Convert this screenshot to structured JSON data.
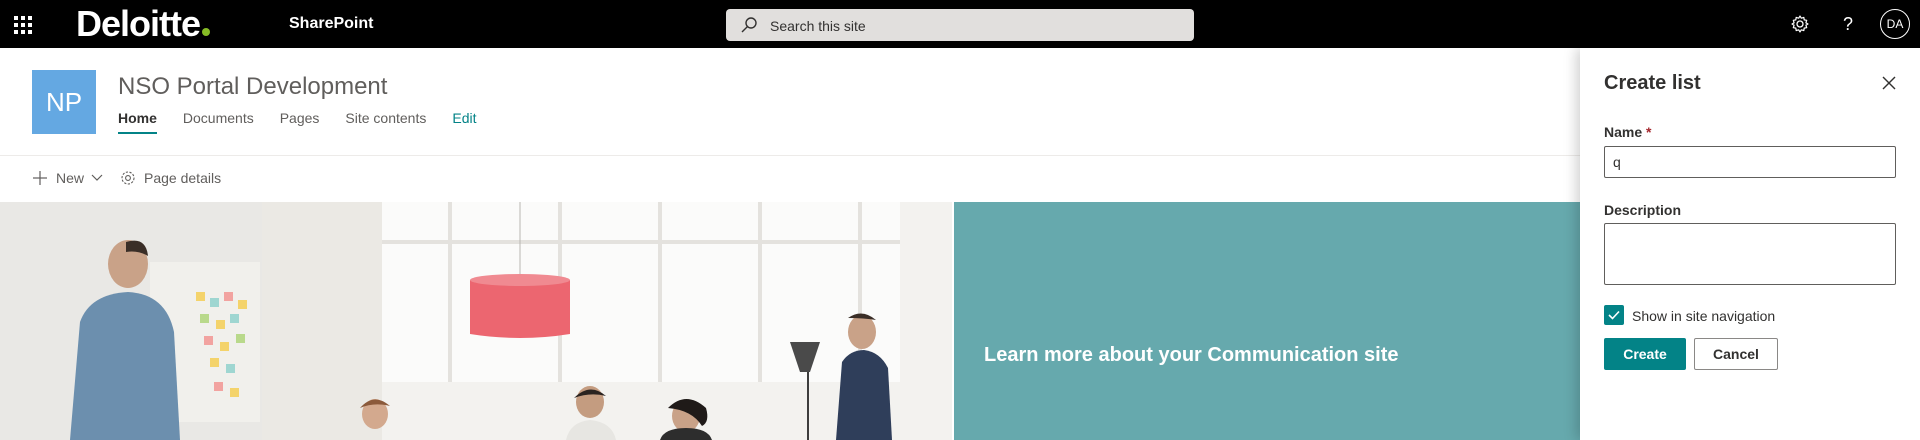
{
  "suitebar": {
    "brand": "Deloitte",
    "app_name": "SharePoint",
    "search_placeholder": "Search this site",
    "avatar_initials": "DA",
    "icons": [
      "app-launcher-icon",
      "settings-icon",
      "help-icon"
    ]
  },
  "site": {
    "logo_initials": "NP",
    "logo_color": "#64a8e2",
    "title": "NSO Portal Development",
    "nav": [
      {
        "label": "Home",
        "active": true
      },
      {
        "label": "Documents"
      },
      {
        "label": "Pages"
      },
      {
        "label": "Site contents"
      },
      {
        "label": "Edit"
      }
    ]
  },
  "commandbar": {
    "new_label": "New",
    "page_details_label": "Page details"
  },
  "hero": {
    "tile_caption": "Learn more about your Communication site",
    "tile_color": "#66a9ad"
  },
  "panel": {
    "title": "Create list",
    "name_label": "Name",
    "name_required_marker": "*",
    "name_value": "q",
    "description_label": "Description",
    "description_value": "",
    "show_in_nav_label": "Show in site navigation",
    "show_in_nav_checked": true,
    "create_label": "Create",
    "cancel_label": "Cancel",
    "accent_color": "#038387"
  }
}
